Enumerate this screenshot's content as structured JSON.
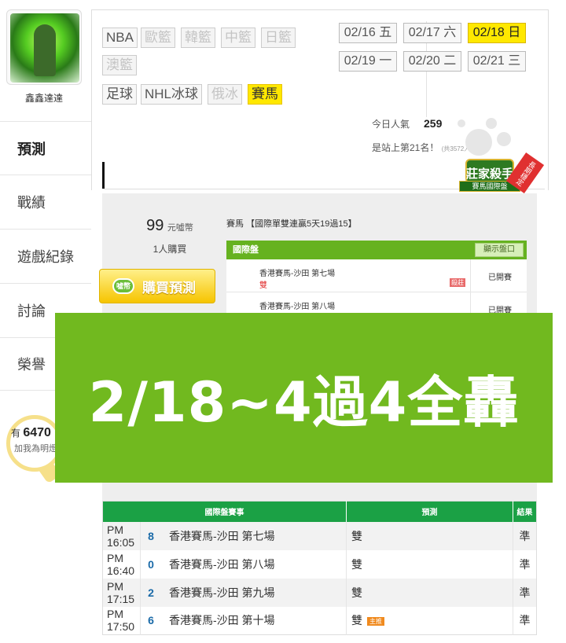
{
  "sidebar": {
    "username": "鑫鑫達達",
    "nav": [
      "預測",
      "戰績",
      "遊戲紀錄",
      "討論",
      "榮譽"
    ],
    "popularity_prefix": "有",
    "popularity_value": "6470",
    "popularity_sub": "加我為明燈"
  },
  "sports": [
    {
      "label": "NBA",
      "state": "normal"
    },
    {
      "label": "歐籃",
      "state": "disabled"
    },
    {
      "label": "韓籃",
      "state": "disabled"
    },
    {
      "label": "中籃",
      "state": "disabled"
    },
    {
      "label": "日籃",
      "state": "disabled"
    },
    {
      "label": "澳籃",
      "state": "disabled"
    },
    {
      "label": "足球",
      "state": "normal"
    },
    {
      "label": "NHL冰球",
      "state": "normal"
    },
    {
      "label": "俄冰",
      "state": "disabled"
    },
    {
      "label": "賽馬",
      "state": "selected"
    }
  ],
  "dates": [
    {
      "date": "02/16",
      "day": "五",
      "selected": false
    },
    {
      "date": "02/17",
      "day": "六",
      "selected": false
    },
    {
      "date": "02/18",
      "day": "日",
      "selected": true
    },
    {
      "date": "02/19",
      "day": "一",
      "selected": false
    },
    {
      "date": "02/20",
      "day": "二",
      "selected": false
    },
    {
      "date": "02/21",
      "day": "三",
      "selected": false
    }
  ],
  "stats": {
    "today_label": "今日人氣",
    "today_value": "259",
    "rank_text": "是站上第21名！",
    "rank_note": "(共3572人)"
  },
  "badge": {
    "title": "莊家殺手",
    "subtitle": "賽馬國際盤",
    "ribbon": "長期穩定"
  },
  "preview": {
    "price": "99",
    "price_unit": "元噓幣",
    "buyers": "1人購買",
    "buy_button": "購買預測",
    "coin_label": "噓幣",
    "title": "賽馬 【國際單雙連贏5天19過15】",
    "table_header": "國際盤",
    "disc_button": "顯示盤口",
    "rows": [
      {
        "race": "香港賽馬-沙田 第七場",
        "pick": "雙",
        "tag": "殺莊",
        "status": "已開賽"
      },
      {
        "race": "香港賽馬-沙田 第八場",
        "pick": "",
        "tag": "",
        "status": "已開賽"
      }
    ]
  },
  "banner": {
    "text": "2/18~4過4全轟"
  },
  "results": {
    "headers": [
      "國際盤賽事",
      "預測",
      "結果"
    ],
    "rows": [
      {
        "time": "PM 16:05",
        "num": "8",
        "race": "香港賽馬-沙田 第七場",
        "pick": "雙",
        "hot": "",
        "result": "準"
      },
      {
        "time": "PM 16:40",
        "num": "0",
        "race": "香港賽馬-沙田 第八場",
        "pick": "雙",
        "hot": "",
        "result": "準"
      },
      {
        "time": "PM 17:15",
        "num": "2",
        "race": "香港賽馬-沙田 第九場",
        "pick": "雙",
        "hot": "",
        "result": "準"
      },
      {
        "time": "PM 17:50",
        "num": "6",
        "race": "香港賽馬-沙田 第十場",
        "pick": "雙",
        "hot": "主推",
        "result": "準"
      }
    ]
  }
}
